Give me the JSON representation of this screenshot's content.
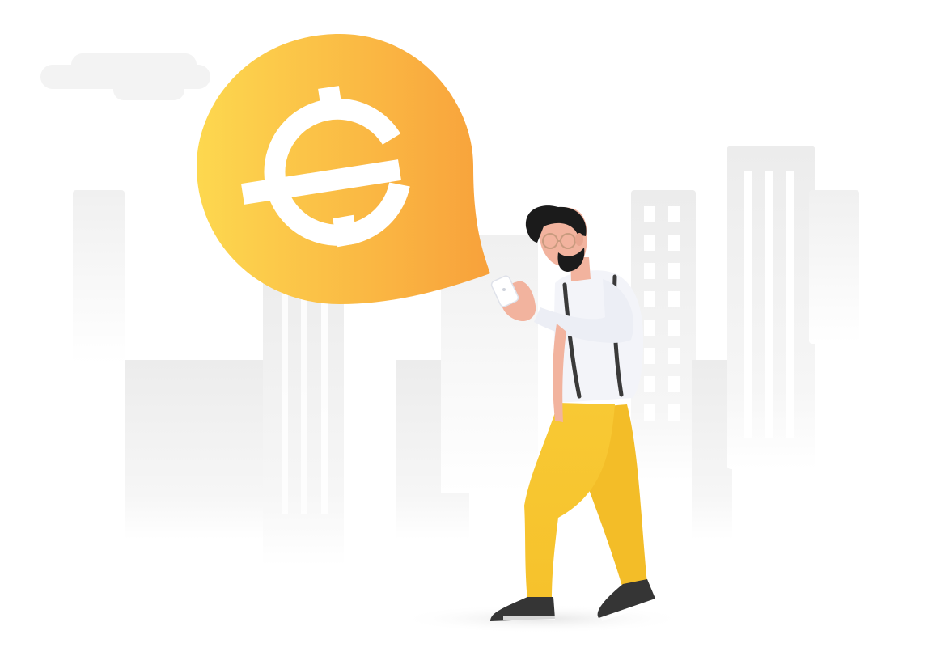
{
  "illustration": {
    "subject": "person-holding-phone",
    "icon": "currency-coin-icon",
    "colors": {
      "background": "#ffffff",
      "buildings": "#eeeeee",
      "bubble_light": "#fcd84e",
      "bubble_dark": "#f8a23a",
      "glyph": "#ffffff",
      "pants": "#f7c630",
      "shirt": "#f3f4f9",
      "hair": "#1b1b1b",
      "skin": "#f2b39e",
      "shoes": "#343434"
    }
  }
}
